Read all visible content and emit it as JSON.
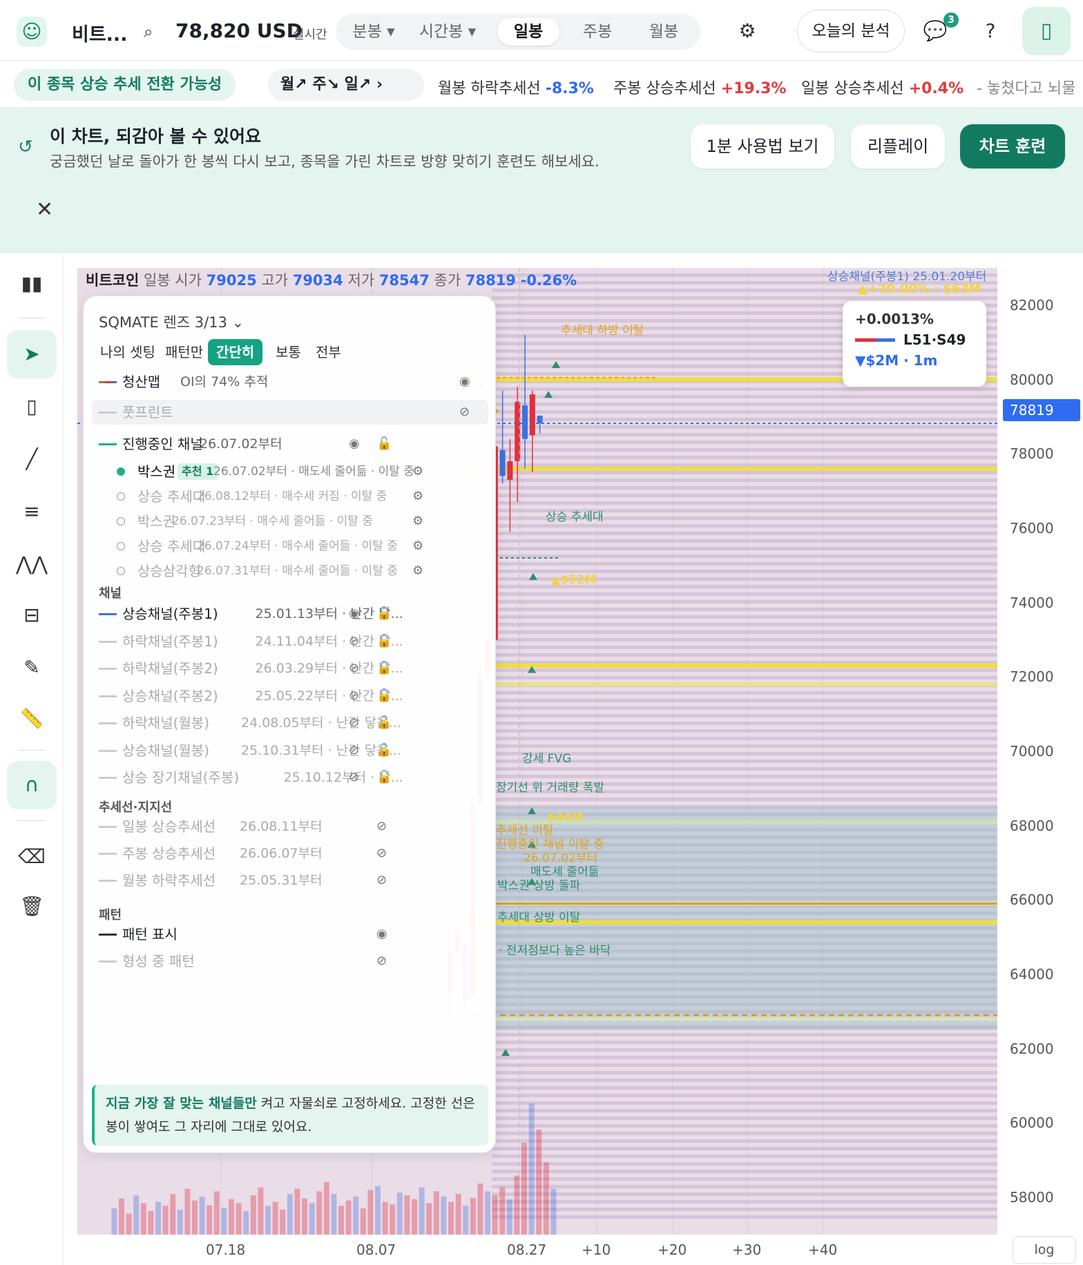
{
  "header": {
    "ticker_name": "비트...",
    "price": "78,820 USD",
    "price_label": "실시간",
    "timeframes": [
      {
        "label": "분봉 ▾"
      },
      {
        "label": "시간봉 ▾"
      },
      {
        "label": "일봉"
      },
      {
        "label": "주봉"
      },
      {
        "label": "월봉"
      }
    ],
    "analysis_button": "오늘의 분석",
    "notification_count": "3"
  },
  "trend_row": {
    "signal": "이 종목 상승 추세 전환 가능성",
    "period_summary": "월↗ 주↘ 일↗ ›",
    "items": [
      {
        "label": "월봉 하락추세선",
        "value": "-8.3%",
        "dir": "neg"
      },
      {
        "label": "주봉 상승추세선",
        "value": "+19.3%",
        "dir": "pos"
      },
      {
        "label": "일봉 상승추세선",
        "value": "+0.4%",
        "dir": "pos"
      }
    ],
    "trailing": "- 놓쳤다고 뇌물"
  },
  "banner": {
    "title": "이 차트, 되감아 볼 수 있어요",
    "subtitle": "궁금했던 날로 돌아가 한 봉씩 다시 보고, 종목을 가린 차트로 방향 맞히기 훈련도 해보세요.",
    "btn_howto": "1분 사용법 보기",
    "btn_replay": "리플레이",
    "btn_training": "차트 훈련"
  },
  "chart": {
    "title": "비트코인",
    "tf": "일봉",
    "open_label": "시가",
    "open": "79025",
    "high_label": "고가",
    "high": "79034",
    "low_label": "저가",
    "low": "78547",
    "close_label": "종가",
    "close": "78819",
    "change": "-0.26%",
    "yticks": [
      "82000",
      "80000",
      "78000",
      "76000",
      "74000",
      "72000",
      "70000",
      "68000",
      "66000",
      "64000",
      "62000",
      "60000",
      "58000"
    ],
    "xticks": [
      "07.18",
      "08.07",
      "08.27",
      "+10",
      "+20",
      "+30",
      "+40"
    ],
    "current_price": "78819",
    "scale_button": "log",
    "tooltip": {
      "pct": "+0.0013%",
      "ls": "L51·S49",
      "flow": "▼$2M · 1m"
    },
    "annotations": {
      "top_channel": "상승채널(주봉1) 25.01.20부터",
      "top_channel_pct": "▲+20.00% · $63M",
      "trend_break": "추세대 하방 이탈",
      "uptrend_band": "상승 추세대",
      "vol_52": "▲$52M",
      "fvg": "강세 FVG",
      "vol_burst": "장기선 위 거래량 폭발",
      "vol_44": "$44M",
      "break1": "추세선 이탈",
      "break2": "진행중인 채널 이탈 중",
      "break3": "26.07.02부터",
      "sell_down": "매도세 줄어듦",
      "box_break": "박스권 상방 돌파",
      "band_break": "추세대 상방 이탈",
      "higher_low": "· 전저점보다 높은 바닥"
    },
    "colors": {
      "bull": "#e0313d",
      "bear": "#3b73e0",
      "accent": "#16a383"
    }
  },
  "chart_data": {
    "type": "candlestick",
    "timeframe": "일봉",
    "yrange": [
      57000,
      83000
    ],
    "xticks": [
      "07.18",
      "08.07",
      "08.27",
      "+10",
      "+20",
      "+30",
      "+40"
    ],
    "candles": [
      {
        "o": 63500,
        "h": 65200,
        "l": 62800,
        "c": 64600
      },
      {
        "o": 64600,
        "h": 66800,
        "l": 64200,
        "c": 65200
      },
      {
        "o": 64800,
        "h": 64900,
        "l": 63100,
        "c": 63300
      },
      {
        "o": 63400,
        "h": 68800,
        "l": 63100,
        "c": 68600
      },
      {
        "o": 68600,
        "h": 72300,
        "l": 68200,
        "c": 72100
      },
      {
        "o": 72100,
        "h": 74700,
        "l": 71900,
        "c": 73000
      },
      {
        "o": 73000,
        "h": 78400,
        "l": 72700,
        "c": 78200
      },
      {
        "o": 78100,
        "h": 79700,
        "l": 77200,
        "c": 77400
      },
      {
        "o": 77300,
        "h": 78400,
        "l": 75900,
        "c": 77800
      },
      {
        "o": 77800,
        "h": 79800,
        "l": 76700,
        "c": 79400
      },
      {
        "o": 79300,
        "h": 81200,
        "l": 77600,
        "c": 78400
      },
      {
        "o": 78500,
        "h": 79700,
        "l": 77500,
        "c": 79600
      },
      {
        "o": 79025,
        "h": 79034,
        "l": 78547,
        "c": 78819
      }
    ]
  },
  "sidebar": {
    "tools": [
      {
        "name": "candle-type-icon"
      },
      {
        "name": "cursor-icon"
      },
      {
        "name": "candle-icon"
      },
      {
        "name": "trendline-icon"
      },
      {
        "name": "horizontal-lines-icon"
      },
      {
        "name": "pattern-icon"
      },
      {
        "name": "fib-icon"
      },
      {
        "name": "pencil-icon"
      },
      {
        "name": "ruler-icon"
      },
      {
        "name": "magnet-icon"
      },
      {
        "name": "eraser-icon"
      },
      {
        "name": "trash-icon"
      }
    ]
  },
  "lens": {
    "title": "SQMATE 렌즈  3/13  ⌄",
    "tabs": [
      {
        "label": "나의 셋팅"
      },
      {
        "label": "패턴만"
      },
      {
        "label": "간단히"
      },
      {
        "label": "보통"
      },
      {
        "label": "전부"
      }
    ],
    "liq": {
      "name": "청산맵",
      "note": "OI의 74% 추적"
    },
    "footprint": {
      "name": "풋프린트"
    },
    "active": {
      "name": "진행중인 채널",
      "date": "26.07.02부터"
    },
    "subs": [
      {
        "name": "박스권",
        "rec": "추천 1",
        "desc": "26.07.02부터 · 매도세 줄어듦 · 이탈 중"
      },
      {
        "name": "상승 추세대",
        "desc": "26.08.12부터 · 매수세 커짐 · 이탈 중"
      },
      {
        "name": "박스권",
        "desc": "26.07.23부터 · 매수세 줄어듦 · 이탈 중"
      },
      {
        "name": "상승 추세대",
        "desc": "26.07.24부터 · 매수세 줄어듦 · 이탈 중"
      },
      {
        "name": "상승삼각형",
        "desc": "26.07.31부터 · 매수세 줄어듦 · 이탈 중"
      }
    ],
    "channel_section": "채널",
    "channels": [
      {
        "name": "상승채널(주봉1)",
        "desc": "25.01.13부터 · 난간 닿...",
        "on": true
      },
      {
        "name": "하락채널(주봉1)",
        "desc": "24.11.04부터 · 난간 닿..."
      },
      {
        "name": "하락채널(주봉2)",
        "desc": "26.03.29부터 · 난간 닿..."
      },
      {
        "name": "상승채널(주봉2)",
        "desc": "25.05.22부터 · 난간 닿..."
      },
      {
        "name": "하락채널(월봉)",
        "desc": "24.08.05부터 · 난간 닿음..."
      },
      {
        "name": "상승채널(월봉)",
        "desc": "25.10.31부터 · 난간 닿음..."
      },
      {
        "name": "상승 장기채널(주봉)",
        "desc": "25.10.12부터 · 난..."
      }
    ],
    "trend_section": "추세선·지지선",
    "trends": [
      {
        "name": "일봉 상승추세선",
        "desc": "26.08.11부터"
      },
      {
        "name": "주봉 상승추세선",
        "desc": "26.06.07부터"
      },
      {
        "name": "월봉 하락추세선",
        "desc": "25.05.31부터"
      }
    ],
    "pattern_section": "패턴",
    "patterns": [
      {
        "name": "패턴 표시",
        "on": true
      },
      {
        "name": "형성 중 패턴"
      }
    ],
    "note_bold": "지금 가장 잘 맞는 채널들만",
    "note_rest": " 켜고 자물쇠로 고정하세요. 고정한 선은 봉이 쌓여도 그 자리에 그대로 있어요."
  }
}
